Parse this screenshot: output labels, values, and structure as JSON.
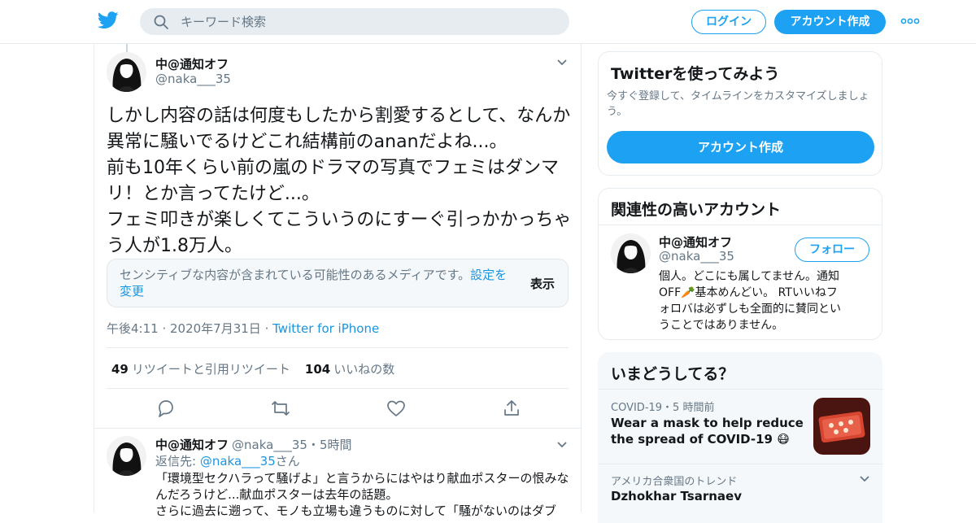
{
  "header": {
    "search_placeholder": "キーワード検索",
    "login_label": "ログイン",
    "signup_label": "アカウント作成"
  },
  "tweet": {
    "author_name": "中@通知オフ",
    "author_handle": "@naka___35",
    "text": "しかし内容の話は何度もしたから割愛するとして、なんか異常に騒いでるけどこれ結構前のananだよね...。\n前も10年くらい前の嵐のドラマの写真でフェミはダンマリ！とか言ってたけど...。\nフェミ叩きが楽しくてこういうのにすーぐ引っかかっちゃう人が1.8万人。",
    "sensitive_text": "センシティブな内容が含まれている可能性のあるメディアです。",
    "sensitive_link": "設定を変更",
    "show_label": "表示",
    "time": "午後4:11",
    "date": "2020年7月31日",
    "source": "Twitter for iPhone",
    "retweets_count": "49",
    "retweets_label": "リツイートと引用リツイート",
    "likes_count": "104",
    "likes_label": "いいねの数"
  },
  "reply": {
    "author_name": "中@通知オフ",
    "author_handle": "@naka___35",
    "time": "5時間",
    "reply_to_label": "返信先:",
    "reply_to_handle": "@naka___35",
    "reply_to_suffix": "さん",
    "text": "「環境型セクハラって騒げよ」と言うからにはやはり献血ポスターの恨みなんだろうけど...献血ポスターは去年の話題。\nさらに過去に遡って、モノも立場も違うものに対して「騒がないのはダブ"
  },
  "sidebar": {
    "signup_card": {
      "title": "Twitterを使ってみよう",
      "subtitle": "今すぐ登録して、タイムラインをカスタマイズしましょう。",
      "button_label": "アカウント作成"
    },
    "related_card": {
      "title": "関連性の高いアカウント",
      "name": "中@通知オフ",
      "handle": "@naka___35",
      "follow_label": "フォロー",
      "bio": "個人。どこにも属してません。通知OFF🥕基本めんどい。 RTいいねフォロバは必ずしも全面的に賛同ということではありません。"
    },
    "trends_card": {
      "title": "いまどうしてる？",
      "trend1_meta": "COVID-19・5 時間前",
      "trend1_title": "Wear a mask to help reduce the spread of COVID-19 😷",
      "trend2_meta": "アメリカ合衆国のトレンド",
      "trend2_title": "Dzhokhar Tsarnaev"
    }
  },
  "colors": {
    "brand": "#1da1f2",
    "link": "#1b95e0",
    "text": "#14171a",
    "muted": "#657786",
    "border": "#e6ecf0"
  },
  "icons": [
    "twitter-logo-icon",
    "search-icon",
    "more-icon",
    "chevron-down-icon",
    "reply-icon",
    "retweet-icon",
    "like-icon",
    "share-icon"
  ]
}
